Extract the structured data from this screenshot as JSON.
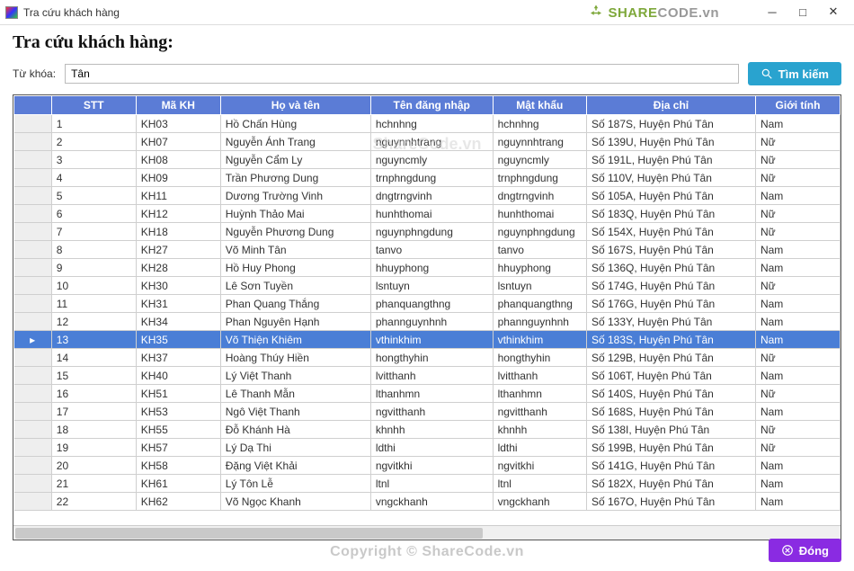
{
  "window": {
    "title": "Tra cứu khách hàng",
    "logo_text_1": "SHARE",
    "logo_text_2": "CODE.vn"
  },
  "heading": "Tra cứu khách hàng:",
  "search": {
    "label": "Từ khóa:",
    "value": "Tân",
    "button_label": "Tìm kiếm"
  },
  "close_button_label": "Đóng",
  "copyright_text": "Copyright © ShareCode.vn",
  "center_watermark": "ShareCode.vn",
  "columns": [
    "",
    "STT",
    "Mã KH",
    "Họ và tên",
    "Tên đăng nhập",
    "Mật khẩu",
    "Địa chỉ",
    "Giới tính"
  ],
  "selected_index": 12,
  "rows": [
    {
      "stt": "1",
      "ma": "KH03",
      "ten": "Hồ Chấn Hùng",
      "user": "hchnhng",
      "pass": "hchnhng",
      "addr": "Số 187S, Huyện Phú Tân",
      "gt": "Nam"
    },
    {
      "stt": "2",
      "ma": "KH07",
      "ten": "Nguyễn Ánh Trang",
      "user": "nguynnhtrang",
      "pass": "nguynnhtrang",
      "addr": "Số 139U, Huyện Phú Tân",
      "gt": "Nữ"
    },
    {
      "stt": "3",
      "ma": "KH08",
      "ten": "Nguyễn Cẩm Ly",
      "user": "nguyncmly",
      "pass": "nguyncmly",
      "addr": "Số 191L, Huyện Phú Tân",
      "gt": "Nữ"
    },
    {
      "stt": "4",
      "ma": "KH09",
      "ten": "Trần Phương Dung",
      "user": "trnphngdung",
      "pass": "trnphngdung",
      "addr": "Số 110V, Huyện Phú Tân",
      "gt": "Nữ"
    },
    {
      "stt": "5",
      "ma": "KH11",
      "ten": "Dương Trường Vinh",
      "user": "dngtrngvinh",
      "pass": "dngtrngvinh",
      "addr": "Số 105A, Huyện Phú Tân",
      "gt": "Nam"
    },
    {
      "stt": "6",
      "ma": "KH12",
      "ten": "Huỳnh Thảo Mai",
      "user": "hunhthomai",
      "pass": "hunhthomai",
      "addr": "Số 183Q, Huyện Phú Tân",
      "gt": "Nữ"
    },
    {
      "stt": "7",
      "ma": "KH18",
      "ten": "Nguyễn Phương Dung",
      "user": "nguynphngdung",
      "pass": "nguynphngdung",
      "addr": "Số 154X, Huyện Phú Tân",
      "gt": "Nữ"
    },
    {
      "stt": "8",
      "ma": "KH27",
      "ten": "Võ Minh Tân",
      "user": "tanvo",
      "pass": "tanvo",
      "addr": "Số 167S, Huyện Phú Tân",
      "gt": "Nam"
    },
    {
      "stt": "9",
      "ma": "KH28",
      "ten": "Hồ Huy Phong",
      "user": "hhuyphong",
      "pass": "hhuyphong",
      "addr": "Số 136Q, Huyện Phú Tân",
      "gt": "Nam"
    },
    {
      "stt": "10",
      "ma": "KH30",
      "ten": "Lê Sơn Tuyền",
      "user": "lsntuyn",
      "pass": "lsntuyn",
      "addr": "Số 174G, Huyện Phú Tân",
      "gt": "Nữ"
    },
    {
      "stt": "11",
      "ma": "KH31",
      "ten": "Phan Quang Thắng",
      "user": "phanquangthng",
      "pass": "phanquangthng",
      "addr": "Số 176G, Huyện Phú Tân",
      "gt": "Nam"
    },
    {
      "stt": "12",
      "ma": "KH34",
      "ten": "Phan Nguyên Hạnh",
      "user": "phannguynhnh",
      "pass": "phannguynhnh",
      "addr": "Số 133Y, Huyện Phú Tân",
      "gt": "Nam"
    },
    {
      "stt": "13",
      "ma": "KH35",
      "ten": "Võ Thiện Khiêm",
      "user": "vthinkhim",
      "pass": "vthinkhim",
      "addr": "Số 183S, Huyện Phú Tân",
      "gt": "Nam"
    },
    {
      "stt": "14",
      "ma": "KH37",
      "ten": "Hoàng Thúy Hiền",
      "user": "hongthyhin",
      "pass": "hongthyhin",
      "addr": "Số 129B, Huyện Phú Tân",
      "gt": "Nữ"
    },
    {
      "stt": "15",
      "ma": "KH40",
      "ten": "Lý Việt Thanh",
      "user": "lvitthanh",
      "pass": "lvitthanh",
      "addr": "Số 106T, Huyện Phú Tân",
      "gt": "Nam"
    },
    {
      "stt": "16",
      "ma": "KH51",
      "ten": "Lê Thanh Mẫn",
      "user": "lthanhmn",
      "pass": "lthanhmn",
      "addr": "Số 140S, Huyện Phú Tân",
      "gt": "Nữ"
    },
    {
      "stt": "17",
      "ma": "KH53",
      "ten": "Ngô Việt Thanh",
      "user": "ngvitthanh",
      "pass": "ngvitthanh",
      "addr": "Số 168S, Huyện Phú Tân",
      "gt": "Nam"
    },
    {
      "stt": "18",
      "ma": "KH55",
      "ten": "Đỗ Khánh Hà",
      "user": "khnhh",
      "pass": "khnhh",
      "addr": "Số 138I, Huyện Phú Tân",
      "gt": "Nữ"
    },
    {
      "stt": "19",
      "ma": "KH57",
      "ten": "Lý Dạ Thi",
      "user": "ldthi",
      "pass": "ldthi",
      "addr": "Số 199B, Huyện Phú Tân",
      "gt": "Nữ"
    },
    {
      "stt": "20",
      "ma": "KH58",
      "ten": "Đặng Việt Khải",
      "user": "ngvitkhi",
      "pass": "ngvitkhi",
      "addr": "Số 141G, Huyện Phú Tân",
      "gt": "Nam"
    },
    {
      "stt": "21",
      "ma": "KH61",
      "ten": "Lý Tôn Lễ",
      "user": "ltnl",
      "pass": "ltnl",
      "addr": "Số 182X, Huyện Phú Tân",
      "gt": "Nam"
    },
    {
      "stt": "22",
      "ma": "KH62",
      "ten": "Võ Ngọc Khanh",
      "user": "vngckhanh",
      "pass": "vngckhanh",
      "addr": "Số 167O, Huyện Phú Tân",
      "gt": "Nam"
    }
  ]
}
